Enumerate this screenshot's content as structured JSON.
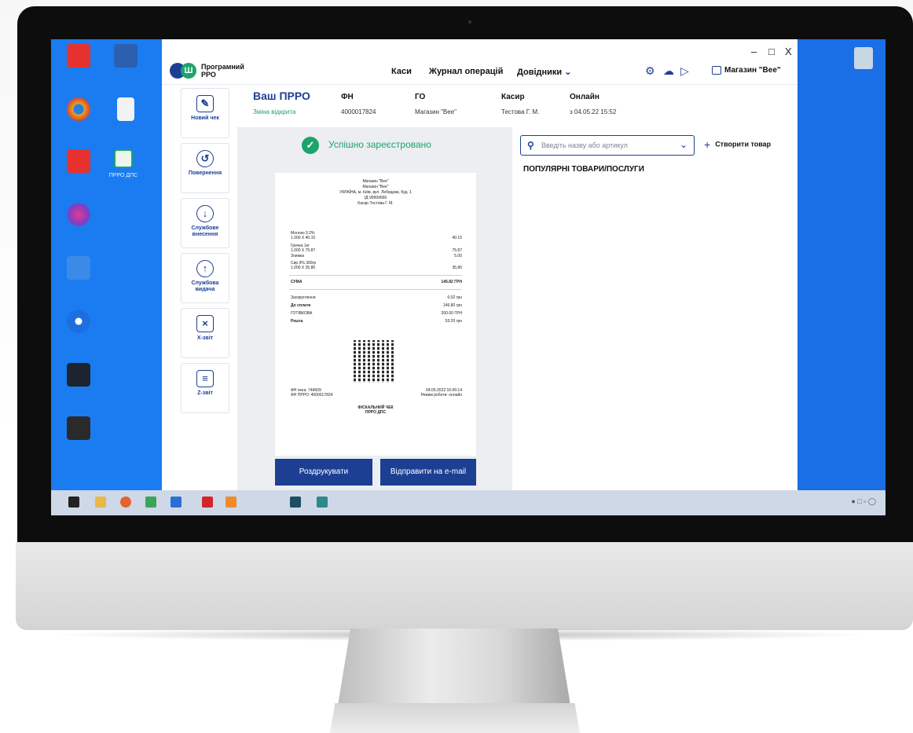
{
  "desktop": {
    "shortcut_label": "ПРРО ДПС"
  },
  "app": {
    "title_line1": "Програмний",
    "title_line2": "РРО",
    "nav": {
      "cash_registers": "Каси",
      "operations_log": "Журнал операцій",
      "directories": "Довідники"
    },
    "store_name": "Магазин \"Bee\"",
    "window_controls": {
      "minimize": "–",
      "maximize": "□",
      "close": "X"
    }
  },
  "sidebar": {
    "items": [
      {
        "label": "Новий чек",
        "icon": "edit-receipt-icon"
      },
      {
        "label": "Повернення",
        "icon": "return-icon"
      },
      {
        "label": "Службове внесення",
        "icon": "arrow-down-icon"
      },
      {
        "label": "Службова видача",
        "icon": "arrow-up-icon"
      },
      {
        "label": "Х-звіт",
        "icon": "x-report-icon"
      },
      {
        "label": "Z-звіт",
        "icon": "z-report-icon"
      }
    ]
  },
  "header": {
    "brand": "Ваш ПРРО",
    "shift_status": "Зміна відкрита",
    "fn_label": "ФН",
    "fn_value": "4000017824",
    "go_label": "ГО",
    "go_value": "Магазин \"Bee\"",
    "cashier_label": "Касир",
    "cashier_value": "Тестова Г. М.",
    "online_label": "Онлайн",
    "online_value": "з 04.05.22 15:52"
  },
  "receipt_pane": {
    "success_text": "Успішно зареєстровано",
    "print_button": "Роздрукувати",
    "email_button": "Відправити на e-mail",
    "receipt": {
      "header_lines": [
        "Магазин \"Bee\"",
        "Магазин \"Bee\"",
        "УКРАЇНА, м. Київ, вул. Лебедєва, буд. 1",
        "ІД 99999666",
        "Касир Тестова Г. М."
      ],
      "items": [
        {
          "name": "Молоко 3.2%",
          "qty": "1.000 Х 40.15",
          "sum": "40.15"
        },
        {
          "name": "Гречка 1кг",
          "qty": "1.000 Х 75.87",
          "sum": "75.87"
        },
        {
          "name": "Знижка",
          "qty": "",
          "sum": "5.00"
        },
        {
          "name": "Сир 9% 300гр",
          "qty": "1.000 Х 35.80",
          "sum": "35.80"
        }
      ],
      "total_label": "СУМА",
      "total_value": "146.82 ГРН",
      "rounding_label": "Заокруглення",
      "rounding_value": "0.02 грн",
      "to_pay_label": "До сплати",
      "to_pay_value": "146.80 грн",
      "cash_label": "ГОТІВКОВА",
      "cash_value": "200.00 ГРН",
      "change_label": "Решта",
      "change_value": "53.20 грн",
      "fn_check": "ФН чека: 744509",
      "fn_prro": "ФН ПРРО: 4000017824",
      "datetime": "04.05.2022 16:06:14",
      "mode": "Режим роботи: онлайн",
      "footer_line1": "ФІСКАЛЬНИЙ ЧЕК",
      "footer_line2": "ПРРО ДПС"
    }
  },
  "products": {
    "search_placeholder": "Введіть назву або артикул",
    "create_button": "Створити товар",
    "popular_heading": "ПОПУЛЯРНІ ТОВАРИ/ПОСЛУГИ"
  },
  "colors": {
    "accent": "#1c3f94",
    "success": "#1da36b",
    "desktop": "#1a7cf0"
  }
}
